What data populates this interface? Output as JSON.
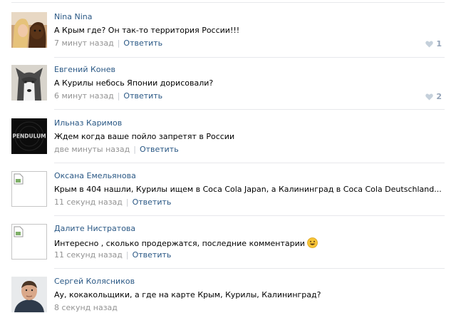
{
  "comments": [
    {
      "author": "Nina Nina",
      "text": "А Крым где? Он так-то территория России!!!",
      "time": "7 минут назад",
      "reply": "Ответить",
      "likes": "1",
      "avatar": "photo-woman-dog"
    },
    {
      "author": "Евгений Конев",
      "text": "А Курилы небось Японии дорисовали?",
      "time": "6 минут назад",
      "reply": "Ответить",
      "likes": "2",
      "avatar": "photo-husky"
    },
    {
      "author": "Ильназ Каримов",
      "text": "Ждем когда ваше пойло запретят в России",
      "time": "две минуты назад",
      "reply": "Ответить",
      "avatar": "pendulum-logo",
      "avatar_text": "PENDULUM"
    },
    {
      "author": "Оксана Емельянова",
      "text": "Крым в 404 нашли, Курилы ищем в Coca Cola Japan, а Калининград в Coca Cola Deutschland...",
      "time": "11 секунд назад",
      "reply": "Ответить",
      "avatar": "broken-image"
    },
    {
      "author": "Далите Нистратова",
      "text": "Интересно , сколько продержатся, последние комментарии",
      "time": "11 секунд назад",
      "reply": "Ответить",
      "avatar": "broken-image",
      "emoji": "smile-emoji"
    },
    {
      "author": "Сергей Колясников",
      "text": "Ау, кокакольщики, а где на карте Крым, Курилы, Калининград?",
      "time": "8 секунд назад",
      "avatar": "photo-man"
    }
  ],
  "colors": {
    "link": "#2a5885",
    "meta": "#939393",
    "likes": "#93a3b8",
    "divider": "#e7e8ec"
  }
}
